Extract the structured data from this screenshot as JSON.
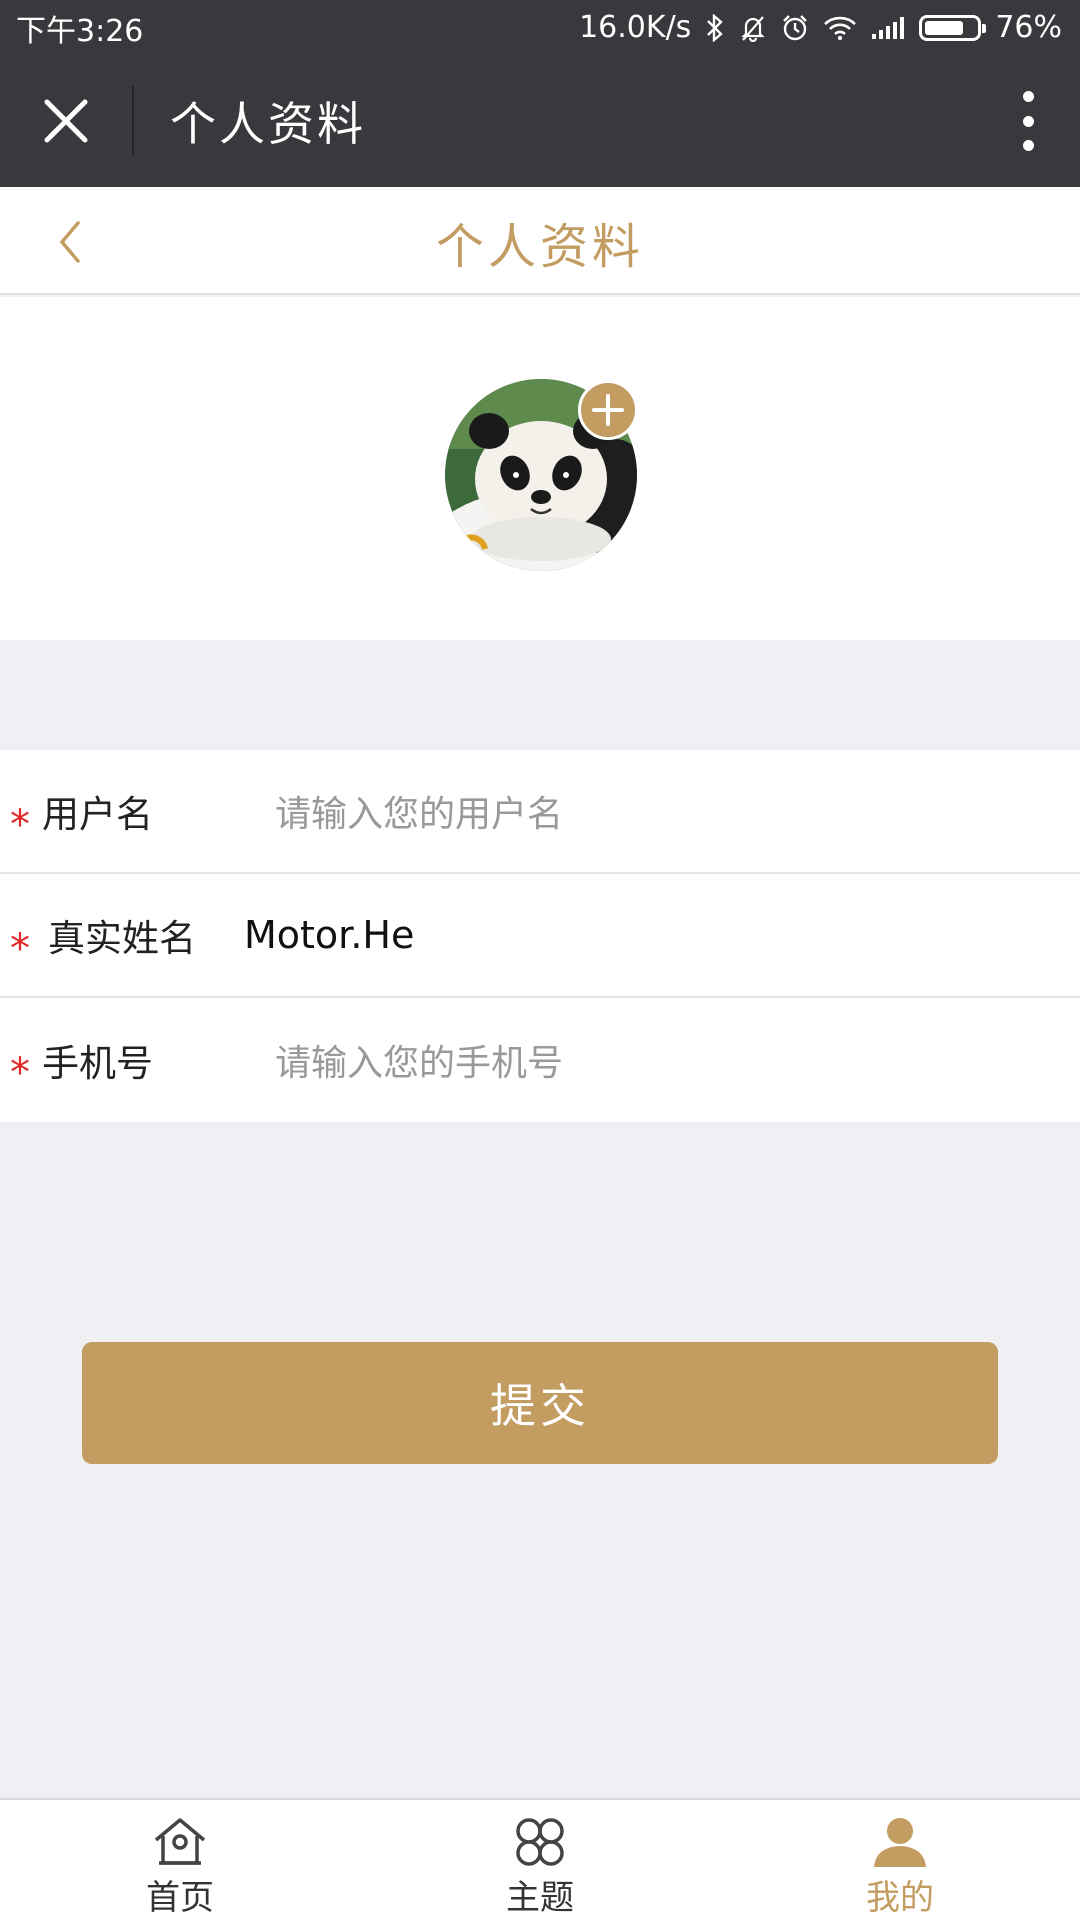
{
  "status_bar": {
    "time": "下午3:26",
    "network_speed": "16.0K/s",
    "battery_percent": "76%",
    "battery_level": 0.76,
    "icons": [
      "bluetooth-icon",
      "mute-bell-icon",
      "alarm-icon",
      "wifi-icon",
      "signal-icon",
      "battery-icon"
    ]
  },
  "nav_bar": {
    "title": "个人资料",
    "close_icon": "close-icon",
    "more_icon": "more-vertical-icon"
  },
  "page_header": {
    "title": "个人资料",
    "back_icon": "chevron-left-icon"
  },
  "avatar": {
    "add_icon": "plus-icon"
  },
  "form": {
    "fields": [
      {
        "label": "用户名",
        "required_mark": "*",
        "placeholder": "请输入您的用户名",
        "value": ""
      },
      {
        "label": "真实姓名",
        "required_mark": "*",
        "placeholder": "",
        "value": "Motor.He"
      },
      {
        "label": "手机号",
        "required_mark": "*",
        "placeholder": "请输入您的手机号",
        "value": ""
      }
    ]
  },
  "submit_label": "提交",
  "tabs": [
    {
      "label": "首页",
      "icon": "home-icon",
      "active": false
    },
    {
      "label": "主题",
      "icon": "clover-icon",
      "active": false
    },
    {
      "label": "我的",
      "icon": "user-icon",
      "active": true
    }
  ],
  "colors": {
    "accent": "#c29c61",
    "dark_bar": "#38393d",
    "background": "#efeff4",
    "required": "#e12424"
  }
}
